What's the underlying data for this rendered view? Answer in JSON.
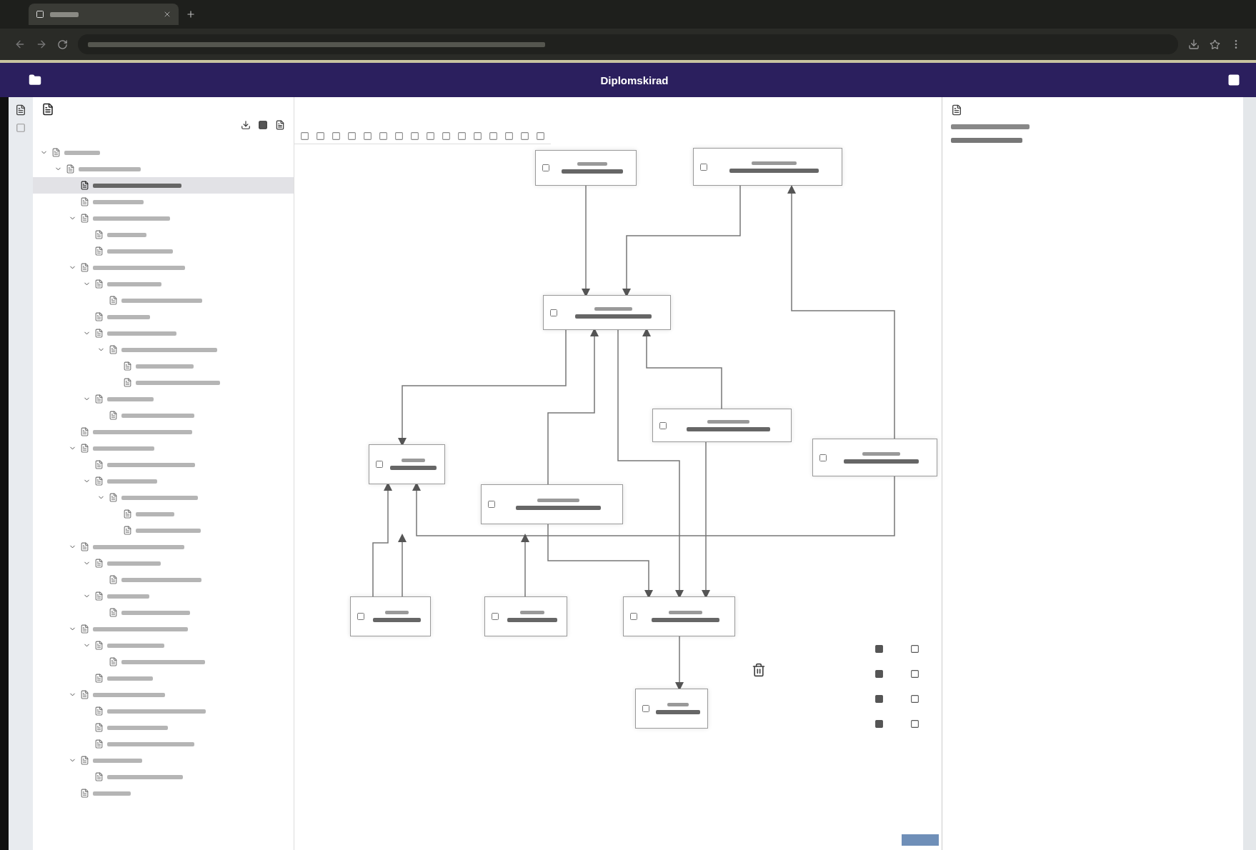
{
  "app_bar": {
    "title": "Diplomskirad"
  },
  "tree": [
    {
      "expanded": true,
      "selected": false,
      "children": [
        {
          "expanded": true,
          "selected": false,
          "children": [
            {
              "selected": true
            },
            {
              "selected": false
            },
            {
              "expanded": true,
              "selected": false,
              "children": [
                {
                  "selected": false
                },
                {
                  "selected": false
                }
              ]
            },
            {
              "expanded": true,
              "selected": false,
              "children": [
                {
                  "expanded": true,
                  "selected": false,
                  "children": [
                    {
                      "selected": false
                    }
                  ]
                },
                {
                  "selected": false
                },
                {
                  "expanded": true,
                  "selected": false,
                  "children": [
                    {
                      "expanded": true,
                      "selected": false,
                      "children": [
                        {
                          "selected": false
                        },
                        {
                          "selected": false
                        }
                      ]
                    }
                  ]
                },
                {
                  "expanded": true,
                  "selected": false,
                  "children": [
                    {
                      "selected": false
                    }
                  ]
                }
              ]
            },
            {
              "selected": false
            },
            {
              "expanded": true,
              "selected": false,
              "children": [
                {
                  "selected": false
                },
                {
                  "expanded": true,
                  "selected": false,
                  "children": [
                    {
                      "expanded": true,
                      "selected": false,
                      "children": [
                        {
                          "selected": false
                        },
                        {
                          "selected": false
                        }
                      ]
                    }
                  ]
                }
              ]
            },
            {
              "expanded": true,
              "selected": false,
              "children": [
                {
                  "expanded": true,
                  "selected": false,
                  "children": [
                    {
                      "selected": false
                    }
                  ]
                },
                {
                  "expanded": true,
                  "selected": false,
                  "children": [
                    {
                      "selected": false
                    }
                  ]
                }
              ]
            },
            {
              "expanded": true,
              "selected": false,
              "children": [
                {
                  "expanded": true,
                  "selected": false,
                  "children": [
                    {
                      "selected": false
                    }
                  ]
                },
                {
                  "selected": false
                }
              ]
            },
            {
              "expanded": true,
              "selected": false,
              "children": [
                {
                  "selected": false
                },
                {
                  "selected": false
                },
                {
                  "selected": false
                }
              ]
            },
            {
              "expanded": true,
              "selected": false,
              "children": [
                {
                  "selected": false
                }
              ]
            },
            {
              "selected": false
            }
          ]
        }
      ]
    }
  ]
}
